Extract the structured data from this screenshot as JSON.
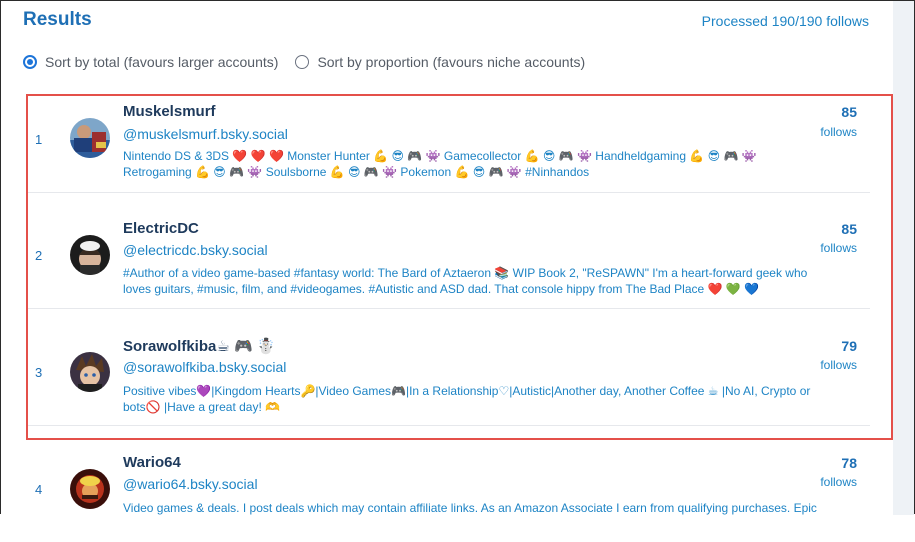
{
  "title": "Results",
  "processed": "Processed 190/190 follows",
  "sort": {
    "option_total": "Sort by total (favours larger accounts)",
    "option_proportion": "Sort by proportion (favours niche accounts)",
    "selected": "total"
  },
  "follows_label": "follows",
  "results": [
    {
      "rank": "1",
      "name": "Muskelsmurf",
      "handle": "@muskelsmurf.bsky.social",
      "bio": "Nintendo DS & 3DS ❤️ ❤️ ❤️ Monster Hunter 💪 😎 🎮 👾 Gamecollector 💪 😎 🎮 👾 Handheldgaming 💪 😎 🎮 👾 Retrogaming 💪 😎 🎮 👾 Soulsborne 💪 😎 🎮 👾 Pokemon 💪 😎 🎮 👾 #Ninhandos",
      "count": "85"
    },
    {
      "rank": "2",
      "name": "ElectricDC",
      "handle": "@electricdc.bsky.social",
      "bio": "#Author of a video game-based #fantasy world: The Bard of Aztaeron 📚 WIP Book 2, \"ReSPAWN\" I'm a heart-forward geek who loves guitars, #music, film, and #videogames. #Autistic and ASD dad. That console hippy from The Bad Place ❤️ 💚 💙",
      "count": "85"
    },
    {
      "rank": "3",
      "name": "Sorawolfkiba☕ 🎮 ☃️",
      "handle": "@sorawolfkiba.bsky.social",
      "bio": "Positive vibes💜|Kingdom Hearts🔑|Video Games🎮|In a Relationship♡|Autistic|Another day, Another Coffee ☕ |No AI, Crypto or bots🚫 |Have a great day! 🫶",
      "count": "79"
    },
    {
      "rank": "4",
      "name": "Wario64",
      "handle": "@wario64.bsky.social",
      "bio": "Video games & deals. I post deals which may contain affiliate links. As an Amazon Associate I earn from qualifying purchases. Epic",
      "count": "78"
    }
  ]
}
